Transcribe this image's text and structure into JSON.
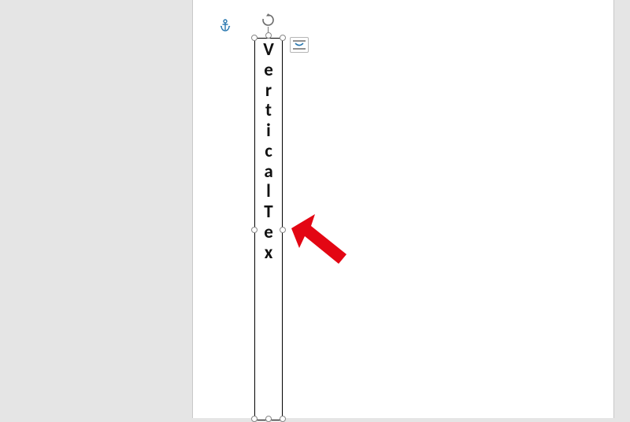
{
  "textbox": {
    "content": "VerticalTex",
    "letters": [
      "V",
      "e",
      "r",
      "t",
      "i",
      "c",
      "a",
      "l",
      "T",
      "e",
      "x"
    ]
  },
  "icons": {
    "anchor": "anchor-icon",
    "rotate": "rotate-handle",
    "layout_options": "layout-options-icon"
  },
  "annotation": {
    "arrow_color": "#e30613"
  }
}
